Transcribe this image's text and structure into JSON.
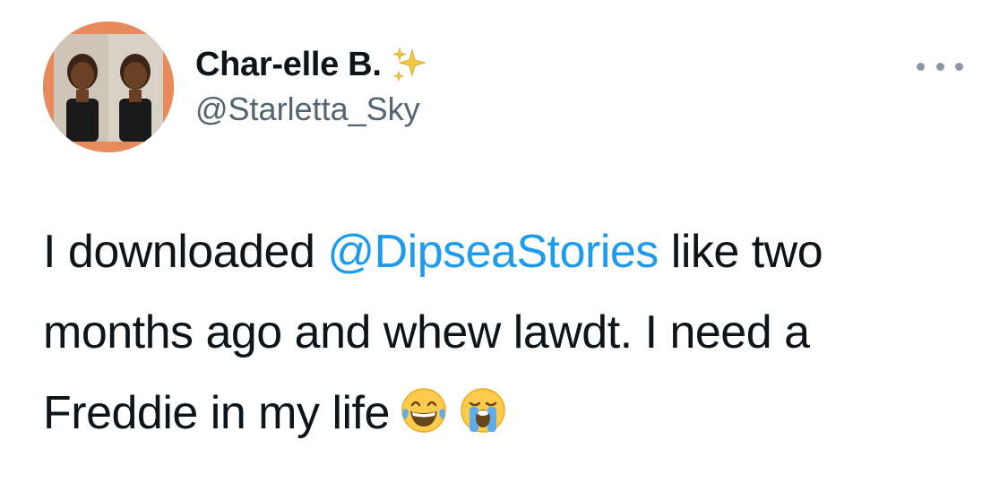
{
  "author": {
    "display_name": "Char-elle B.",
    "handle": "@Starletta_Sky",
    "name_emoji": "sparkles-icon",
    "avatar_border_color": "#e88a5c"
  },
  "more_menu": {
    "icon": "more-horizontal-icon"
  },
  "tweet": {
    "line1_before": "I downloaded ",
    "mention": "@DipseaStories",
    "line1_after": " like two",
    "line2": "months ago and whew lawdt. I need a",
    "line3": "Freddie in my life",
    "emojis": [
      "face-with-tears-of-joy-icon",
      "loudly-crying-face-icon"
    ]
  },
  "colors": {
    "text": "#0f1419",
    "secondary": "#536471",
    "mention": "#1d9bf0"
  }
}
